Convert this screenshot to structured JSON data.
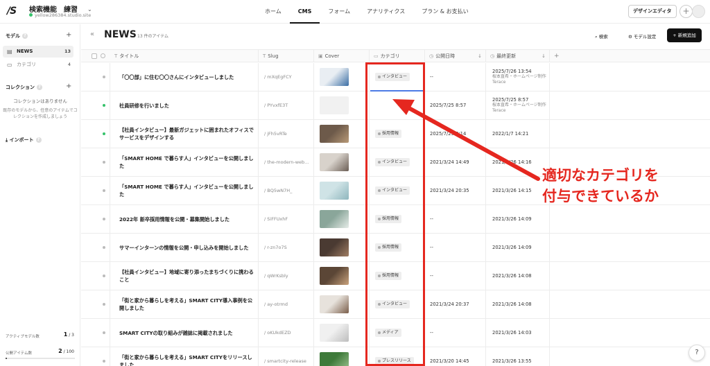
{
  "topbar": {
    "logo": "/S",
    "site_name": "検索機能　練習",
    "site_url": "yellow286384.studio.site",
    "nav": [
      "ホーム",
      "CMS",
      "フォーム",
      "アナリティクス",
      "プラン & お支払い"
    ],
    "active_nav": "CMS",
    "design_editor": "デザインエディタ"
  },
  "sidebar": {
    "models_heading": "モデル",
    "models": [
      {
        "label": "NEWS",
        "count": "13"
      },
      {
        "label": "カテゴリ",
        "count": "4"
      }
    ],
    "collections_heading": "コレクション",
    "collections_empty_title": "コレクションはありません",
    "collections_empty_desc": "既存のモデルから、任意のアイテムでコレクションを作成しましょう",
    "import_label": "インポート",
    "active_models_label": "アクティブモデル数",
    "active_models_value": "1",
    "active_models_max": "/ 3",
    "published_items_label": "公開アイテム数",
    "published_items_value": "2",
    "published_items_max": "/ 100",
    "published_items_fraction": 0.02
  },
  "main": {
    "title": "NEWS",
    "item_count": "13 件のアイテム",
    "search_label": "検索",
    "model_settings_label": "モデル設定",
    "add_new_label": "新規追加"
  },
  "table": {
    "headers": {
      "title": "タイトル",
      "slug": "Slug",
      "cover": "Cover",
      "category": "カテゴリ",
      "published": "公開日時",
      "updated": "最終更新"
    },
    "rows": [
      {
        "status": "draft",
        "title": "「〇〇部」に住む〇〇さんにインタビューしました",
        "slug": "/ mXqEgFCY",
        "cover": [
          "#e9eef3",
          "#3b6ea5"
        ],
        "category": "インタビュー",
        "published": "--",
        "updated": "2025/7/26 13:54",
        "updated_by": "桜本直希・ホームページ制作Terace"
      },
      {
        "status": "published",
        "title": "社員研修を行いました",
        "slug": "/ PYvxfE3T",
        "cover": [
          "#f1f1f1",
          "#f1f1f1"
        ],
        "category": "",
        "published": "2025/7/25 8:57",
        "updated": "2025/7/25 8:57",
        "updated_by": "桜本直希・ホームページ制作Terace"
      },
      {
        "status": "published",
        "title": "【社員インタビュー】最新ガジェットに囲まれたオフィスでサービスをデザインする",
        "slug": "/ jFh5vRTe",
        "cover": [
          "#6d5a4a",
          "#b89a78"
        ],
        "category": "採用情報",
        "published": "2025/7/25 8:14",
        "updated": "2022/1/7 14:21",
        "updated_by": ""
      },
      {
        "status": "draft",
        "title": "「SMART HOME で暮らす人」インタビューを公開しました",
        "slug": "/ the-modern-web...",
        "cover": [
          "#d8d2cb",
          "#6b5e55"
        ],
        "category": "インタビュー",
        "published": "2021/3/24 14:49",
        "updated": "2021/3/26 14:16",
        "updated_by": ""
      },
      {
        "status": "draft",
        "title": "「SMART HOME で暮らす人」インタビューを公開しました",
        "slug": "/ BQ5wN7H_",
        "cover": [
          "#cfe3e6",
          "#8fb6bd"
        ],
        "category": "インタビュー",
        "published": "2021/3/24 20:35",
        "updated": "2021/3/26 14:15",
        "updated_by": ""
      },
      {
        "status": "draft",
        "title": "2022年 新卒採用情報を公開・募集開始しました",
        "slug": "/ SiFFUxhF",
        "cover": [
          "#8aa69a",
          "#e6ece8"
        ],
        "category": "採用情報",
        "published": "--",
        "updated": "2021/3/26 14:09",
        "updated_by": ""
      },
      {
        "status": "draft",
        "title": "サマーインターンの情報を公開・申し込みを開始しました",
        "slug": "/ r-zn7o7S",
        "cover": [
          "#4a3a32",
          "#a07e64"
        ],
        "category": "採用情報",
        "published": "--",
        "updated": "2021/3/26 14:09",
        "updated_by": ""
      },
      {
        "status": "draft",
        "title": "【社員インタビュー】地域に寄り添ったまちづくりに携わること",
        "slug": "/ qWrKsbly",
        "cover": [
          "#5b4636",
          "#c9a27c"
        ],
        "category": "採用情報",
        "published": "--",
        "updated": "2021/3/26 14:08",
        "updated_by": ""
      },
      {
        "status": "draft",
        "title": "「街と家から暮らしを考える」SMART CITY導入事例を公開しました",
        "slug": "/ ay-otrmd",
        "cover": [
          "#e7e2dc",
          "#7a5e4a"
        ],
        "category": "インタビュー",
        "published": "2021/3/24 20:37",
        "updated": "2021/3/26 14:08",
        "updated_by": ""
      },
      {
        "status": "draft",
        "title": "SMART CITYの取り組みが雑誌に掲載されました",
        "slug": "/ oKUkdEZD",
        "cover": [
          "#f0f0f0",
          "#bdbdbd"
        ],
        "category": "メディア",
        "published": "--",
        "updated": "2021/3/26 14:03",
        "updated_by": ""
      },
      {
        "status": "draft",
        "title": "「街と家から暮らしを考える」SMART CITYをリリースしました",
        "slug": "/ smartcity-release",
        "cover": [
          "#3e7a3a",
          "#9cc28f"
        ],
        "category": "プレスリリース",
        "published": "2021/3/20 14:45",
        "updated": "2021/3/26 13:55",
        "updated_by": ""
      }
    ]
  },
  "annotation": {
    "text_line1": "適切なカテゴリを",
    "text_line2": "付与できているか",
    "color": "#e5271f"
  },
  "help_button": "?"
}
